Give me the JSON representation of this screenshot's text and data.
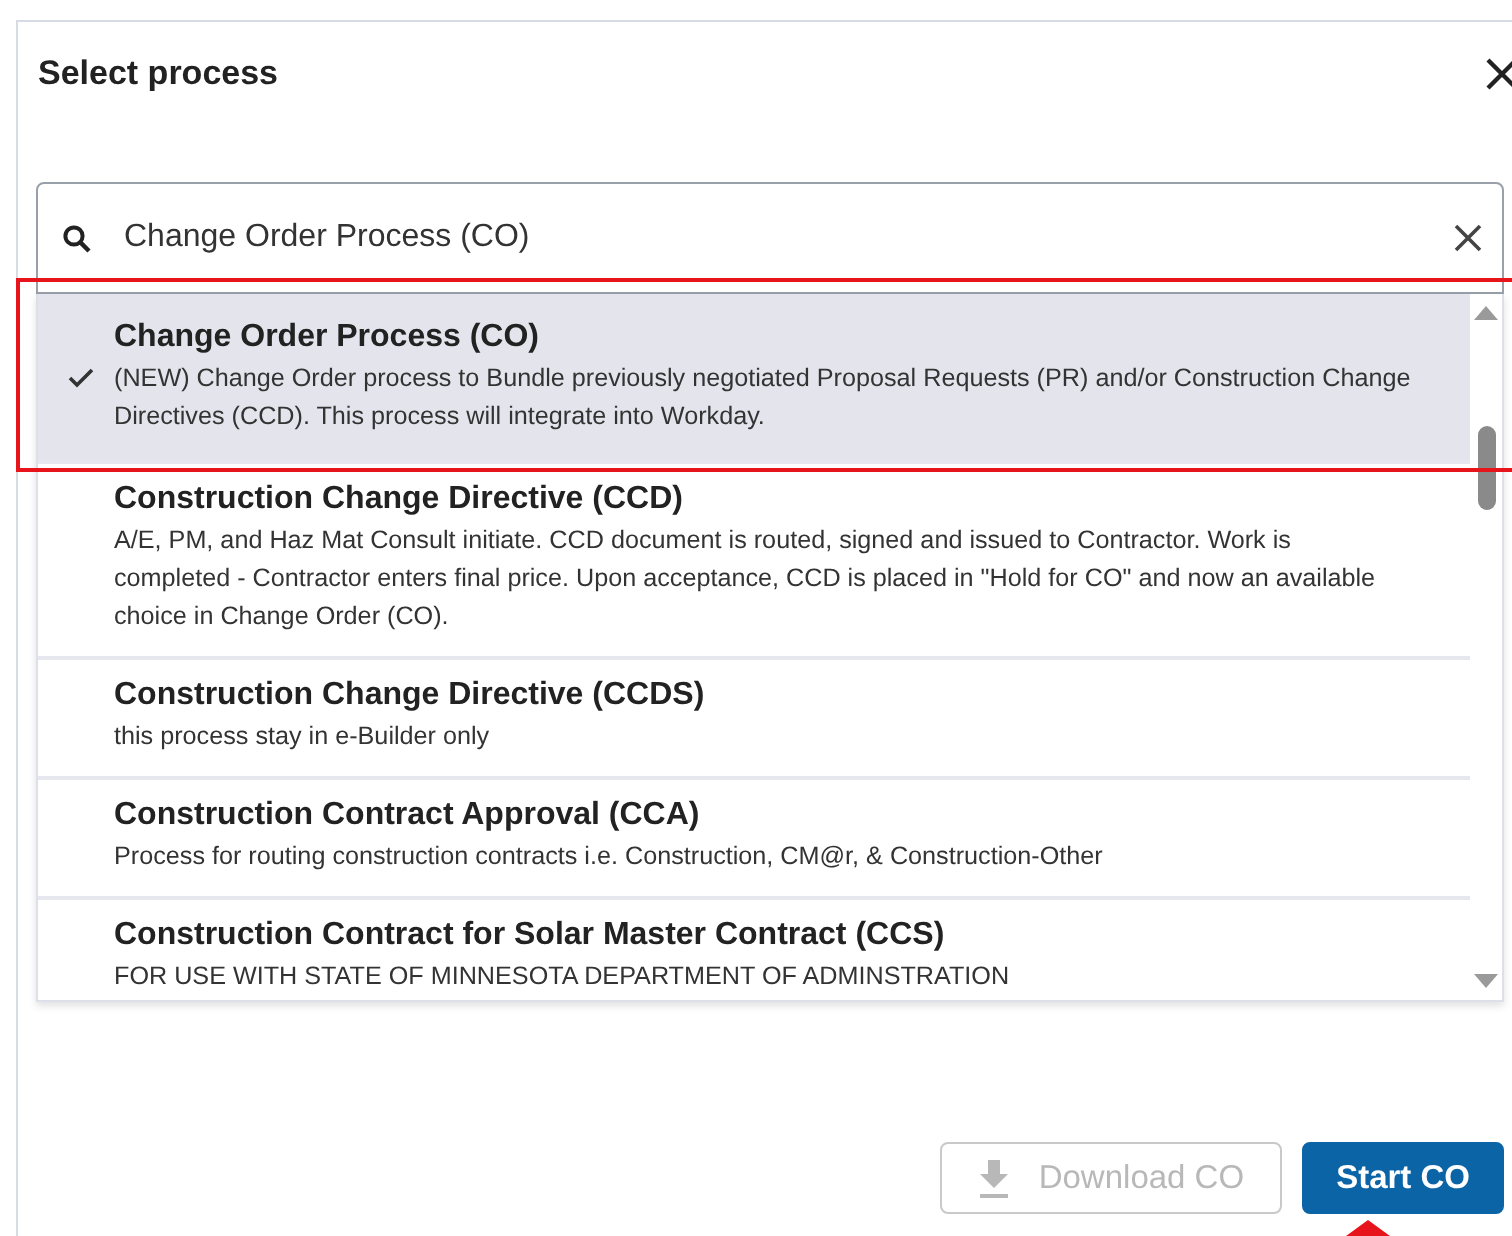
{
  "dialog": {
    "title": "Select process"
  },
  "search": {
    "value": "Change Order Process (CO)"
  },
  "processes": [
    {
      "name": "Change Order Process (CO)",
      "description": "(NEW) Change Order process to Bundle previously negotiated Proposal Requests (PR) and/or Construction Change Directives (CCD). This process will integrate into Workday.",
      "selected": true
    },
    {
      "name": "Construction Change Directive (CCD)",
      "description": "A/E, PM, and Haz Mat Consult initiate. CCD document is routed, signed and issued to Contractor. Work is completed - Contractor enters final price. Upon acceptance, CCD is placed in \"Hold for CO\" and now an available choice in Change Order (CO).",
      "selected": false
    },
    {
      "name": "Construction Change Directive (CCDS)",
      "description": "this process stay in e-Builder only",
      "selected": false
    },
    {
      "name": "Construction Contract Approval (CCA)",
      "description": "Process for routing construction contracts i.e. Construction, CM@r, & Construction-Other",
      "selected": false
    },
    {
      "name": "Construction Contract for Solar Master Contract (CCS)",
      "description": "FOR USE WITH STATE OF MINNESOTA DEPARTMENT OF ADMINSTRATION",
      "selected": false
    }
  ],
  "buttons": [
    {
      "label": "Download CO",
      "kind": "secondary",
      "disabled": true
    },
    {
      "label": "Start CO",
      "kind": "primary",
      "disabled": false
    }
  ],
  "annotations": {
    "highlight_selected": true,
    "arrow_to_start": true
  }
}
